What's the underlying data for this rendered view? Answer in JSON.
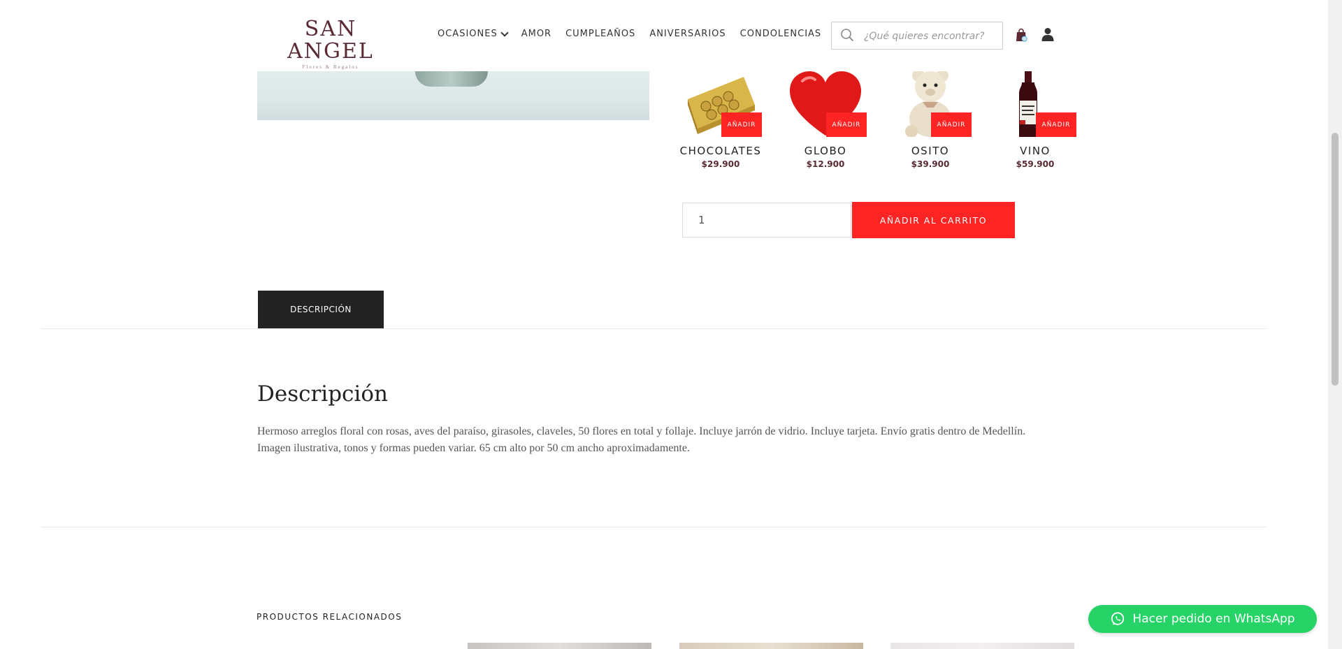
{
  "logo": {
    "main": "SAN ANGEL",
    "sub": "Flores & Regalos"
  },
  "nav": {
    "items": [
      "OCASIONES",
      "AMOR",
      "CUMPLEAÑOS",
      "ANIVERSARIOS",
      "CONDOLENCIAS"
    ]
  },
  "search": {
    "placeholder": "¿Qué quieres encontrar?",
    "value": ""
  },
  "cart": {
    "count": "0"
  },
  "addons": [
    {
      "name": "CHOCOLATES",
      "price": "$29.900",
      "button": "AÑADIR",
      "icon": "chocolate-box"
    },
    {
      "name": "GLOBO",
      "price": "$12.900",
      "button": "AÑADIR",
      "icon": "heart-balloon"
    },
    {
      "name": "OSITO",
      "price": "$39.900",
      "button": "AÑADIR",
      "icon": "teddy-bear"
    },
    {
      "name": "VINO",
      "price": "$59.900",
      "button": "AÑADIR",
      "icon": "wine-bottle"
    }
  ],
  "purchase": {
    "quantity": "1",
    "add_to_cart": "AÑADIR AL CARRITO"
  },
  "tabs": {
    "description": "DESCRIPCIÓN"
  },
  "description": {
    "title": "Descripción",
    "text": "Hermoso arreglos floral con rosas, aves del paraíso, girasoles, claveles, 50 flores en total y follaje. Incluye jarrón de vidrio. Incluye tarjeta. Envío gratis dentro de Medellín. Imagen ilustrativa, tonos y formas pueden variar. 65 cm alto por 50 cm ancho aproximadamente."
  },
  "related": {
    "heading": "PRODUCTOS RELACIONADOS"
  },
  "whatsapp": {
    "label": "Hacer pedido en WhatsApp"
  },
  "colors": {
    "accent": "#ff2424",
    "brand": "#5a2a33",
    "whatsapp": "#25d366",
    "tab": "#222222"
  }
}
